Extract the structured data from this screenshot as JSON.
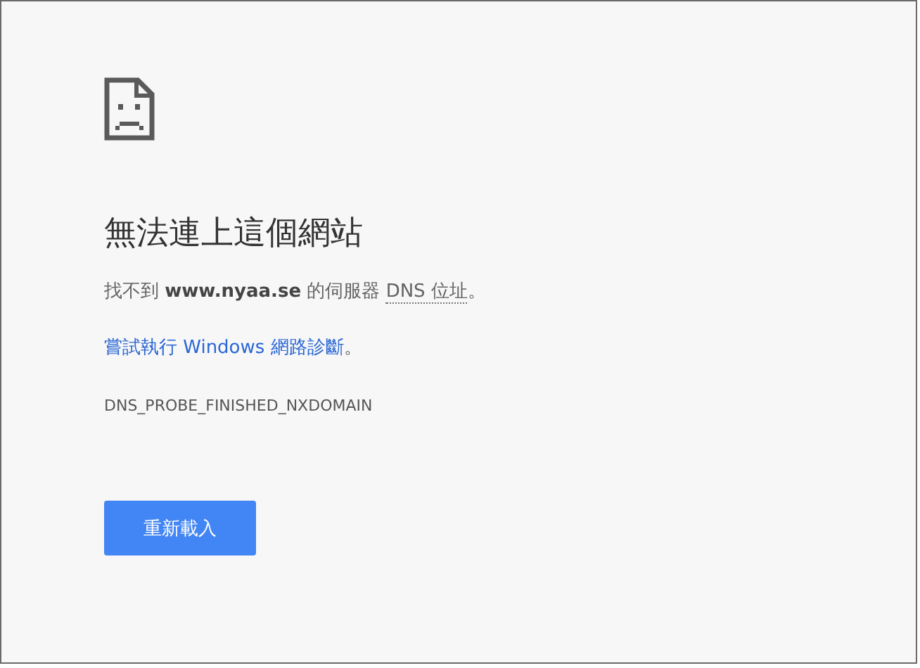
{
  "heading": "無法連上這個網站",
  "message": {
    "before": "找不到 **www.nyaa.se** 的伺服器 ",
    "abbr": "DNS 位址",
    "after": "。"
  },
  "suggestion": {
    "link": "嘗試執行 Windows 網路診斷",
    "after": "。"
  },
  "error_code": "DNS_PROBE_FINISHED_NXDOMAIN",
  "buttons": [
    {
      "label": "重新載入",
      "kind": "primary"
    }
  ]
}
